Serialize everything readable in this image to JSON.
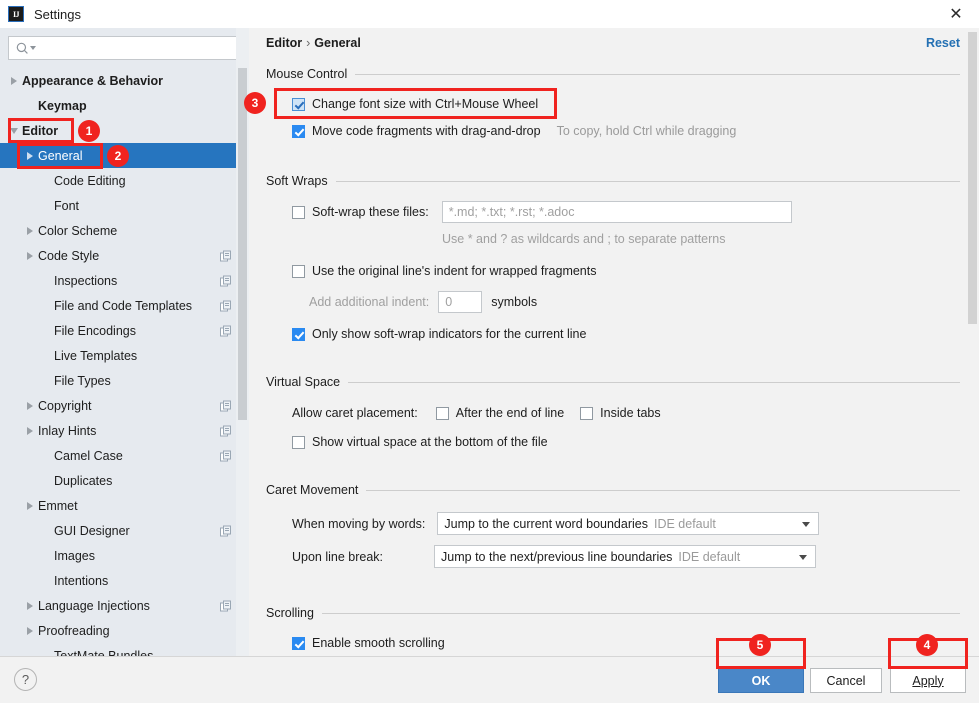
{
  "window": {
    "title": "Settings",
    "app_icon": "IJ",
    "close_label": "✕"
  },
  "search": {
    "value": "",
    "placeholder": "",
    "icon": "search-icon"
  },
  "sidebar": {
    "items": [
      {
        "label": "Appearance & Behavior",
        "arrow": "right",
        "bold": true,
        "indent": 6,
        "selected": false,
        "copy": false
      },
      {
        "label": "Keymap",
        "arrow": "none",
        "bold": true,
        "indent": 22,
        "selected": false,
        "copy": false
      },
      {
        "label": "Editor",
        "arrow": "down",
        "bold": true,
        "indent": 6,
        "selected": false,
        "copy": false
      },
      {
        "label": "General",
        "arrow": "right",
        "bold": false,
        "indent": 22,
        "selected": true,
        "copy": false
      },
      {
        "label": "Code Editing",
        "arrow": "none",
        "bold": false,
        "indent": 38,
        "selected": false,
        "copy": false
      },
      {
        "label": "Font",
        "arrow": "none",
        "bold": false,
        "indent": 38,
        "selected": false,
        "copy": false
      },
      {
        "label": "Color Scheme",
        "arrow": "right",
        "bold": false,
        "indent": 22,
        "selected": false,
        "copy": false
      },
      {
        "label": "Code Style",
        "arrow": "right",
        "bold": false,
        "indent": 22,
        "selected": false,
        "copy": true
      },
      {
        "label": "Inspections",
        "arrow": "none",
        "bold": false,
        "indent": 38,
        "selected": false,
        "copy": true
      },
      {
        "label": "File and Code Templates",
        "arrow": "none",
        "bold": false,
        "indent": 38,
        "selected": false,
        "copy": true
      },
      {
        "label": "File Encodings",
        "arrow": "none",
        "bold": false,
        "indent": 38,
        "selected": false,
        "copy": true
      },
      {
        "label": "Live Templates",
        "arrow": "none",
        "bold": false,
        "indent": 38,
        "selected": false,
        "copy": false
      },
      {
        "label": "File Types",
        "arrow": "none",
        "bold": false,
        "indent": 38,
        "selected": false,
        "copy": false
      },
      {
        "label": "Copyright",
        "arrow": "right",
        "bold": false,
        "indent": 22,
        "selected": false,
        "copy": true
      },
      {
        "label": "Inlay Hints",
        "arrow": "right",
        "bold": false,
        "indent": 22,
        "selected": false,
        "copy": true
      },
      {
        "label": "Camel Case",
        "arrow": "none",
        "bold": false,
        "indent": 38,
        "selected": false,
        "copy": true
      },
      {
        "label": "Duplicates",
        "arrow": "none",
        "bold": false,
        "indent": 38,
        "selected": false,
        "copy": false
      },
      {
        "label": "Emmet",
        "arrow": "right",
        "bold": false,
        "indent": 22,
        "selected": false,
        "copy": false
      },
      {
        "label": "GUI Designer",
        "arrow": "none",
        "bold": false,
        "indent": 38,
        "selected": false,
        "copy": true
      },
      {
        "label": "Images",
        "arrow": "none",
        "bold": false,
        "indent": 38,
        "selected": false,
        "copy": false
      },
      {
        "label": "Intentions",
        "arrow": "none",
        "bold": false,
        "indent": 38,
        "selected": false,
        "copy": false
      },
      {
        "label": "Language Injections",
        "arrow": "right",
        "bold": false,
        "indent": 22,
        "selected": false,
        "copy": true
      },
      {
        "label": "Proofreading",
        "arrow": "right",
        "bold": false,
        "indent": 22,
        "selected": false,
        "copy": false
      },
      {
        "label": "TextMate Bundles",
        "arrow": "none",
        "bold": false,
        "indent": 38,
        "selected": false,
        "copy": false
      }
    ]
  },
  "header": {
    "breadcrumb_root": "Editor",
    "breadcrumb_sep": "›",
    "breadcrumb_leaf": "General",
    "reset_label": "Reset"
  },
  "sections": {
    "mouse_control": {
      "title": "Mouse Control",
      "change_font_size": {
        "label": "Change font size with Ctrl+Mouse Wheel",
        "checked": true,
        "focused": true
      },
      "move_code_fragments": {
        "label": "Move code fragments with drag-and-drop",
        "checked": true
      },
      "move_code_hint": "To copy, hold Ctrl while dragging"
    },
    "soft_wraps": {
      "title": "Soft Wraps",
      "softwrap_files": {
        "label": "Soft-wrap these files:",
        "checked": false
      },
      "softwrap_files_value": "*.md; *.txt; *.rst; *.adoc",
      "wildcards_hint": "Use * and ? as wildcards and ; to separate patterns",
      "original_indent": {
        "label": "Use the original line's indent for wrapped fragments",
        "checked": false
      },
      "add_indent_label": "Add additional indent:",
      "add_indent_value": "0",
      "symbols_label": "symbols",
      "only_show_indicators": {
        "label": "Only show soft-wrap indicators for the current line",
        "checked": true
      }
    },
    "virtual_space": {
      "title": "Virtual Space",
      "allow_caret_label": "Allow caret placement:",
      "after_end_of_line": {
        "label": "After the end of line",
        "checked": false
      },
      "inside_tabs": {
        "label": "Inside tabs",
        "checked": false
      },
      "show_virtual_space": {
        "label": "Show virtual space at the bottom of the file",
        "checked": false
      }
    },
    "caret_movement": {
      "title": "Caret Movement",
      "when_moving_label": "When moving by words:",
      "when_moving_value": "Jump to the current word boundaries",
      "when_moving_sub": "IDE default",
      "upon_line_break_label": "Upon line break:",
      "upon_line_break_value": "Jump to the next/previous line boundaries",
      "upon_line_break_sub": "IDE default"
    },
    "scrolling": {
      "title": "Scrolling",
      "enable_smooth": {
        "label": "Enable smooth scrolling",
        "checked": true
      }
    }
  },
  "footer": {
    "help_label": "?",
    "ok_label": "OK",
    "cancel_label": "Cancel",
    "apply_label": "Apply"
  },
  "annotations": {
    "badges": [
      {
        "n": "1"
      },
      {
        "n": "2"
      },
      {
        "n": "3"
      },
      {
        "n": "4"
      },
      {
        "n": "5"
      }
    ],
    "accent_color": "#f0231f"
  }
}
